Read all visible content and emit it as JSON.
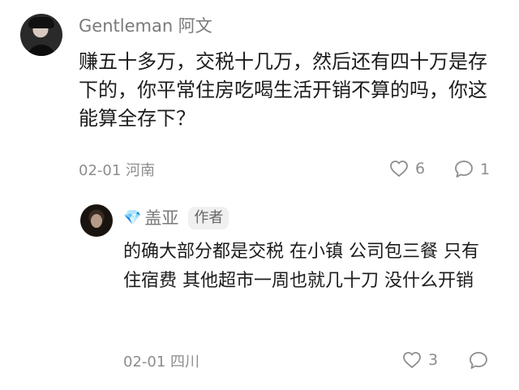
{
  "comment": {
    "username": "Gentleman 阿文",
    "text": "赚五十多万，交税十几万，然后还有四十万是存下的，你平常住房吃喝生活开销不算的吗，你这能算全存下？",
    "date": "02-01",
    "location": "河南",
    "likes": "6",
    "replies": "1"
  },
  "reply": {
    "username": "盖亚",
    "badge_icon": "diamond-icon",
    "author_label": "作者",
    "text": "的确大部分都是交税 在小镇 公司包三餐 只有住宿费 其他超市一周也就几十刀 没什么开销",
    "date": "02-01",
    "location": "四川",
    "likes": "3"
  },
  "colors": {
    "text": "#1c1c1c",
    "meta": "#8d8d8d",
    "badge": "#58b7f0"
  }
}
